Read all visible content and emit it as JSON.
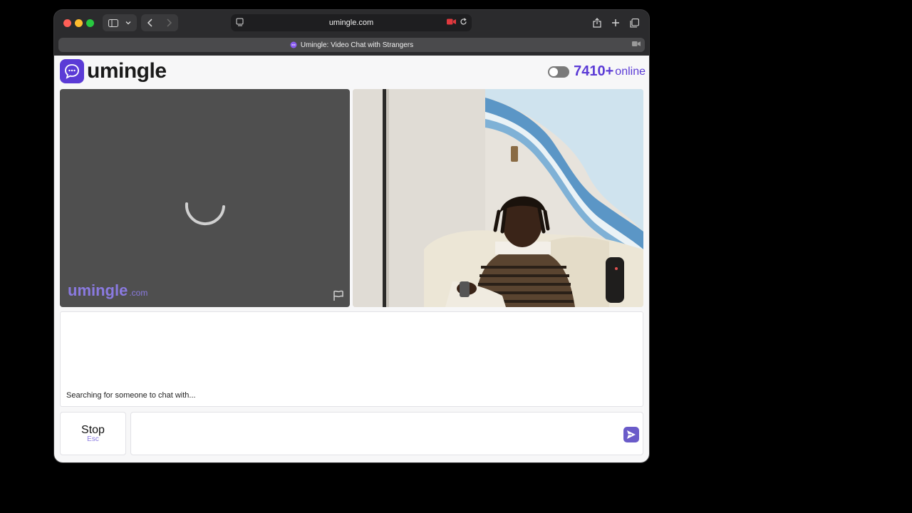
{
  "browser": {
    "url": "umingle.com",
    "tab_title": "Umingle: Video Chat with Strangers",
    "icons": {
      "sidebar": "sidebar-icon",
      "back": "chevron-left-icon",
      "forward": "chevron-right-icon",
      "reader": "reader-icon",
      "camera": "camera-recording-icon",
      "reload": "reload-icon",
      "share": "share-icon",
      "new_tab": "plus-icon",
      "tabs": "tab-overview-icon"
    }
  },
  "header": {
    "logo_text": "umingle",
    "online_count": "7410+",
    "online_label": "online"
  },
  "video": {
    "watermark_main": "umingle",
    "watermark_suffix": ".com"
  },
  "chat": {
    "status": "Searching for someone to chat with...",
    "message_placeholder": ""
  },
  "controls": {
    "stop_label": "Stop",
    "stop_key": "Esc"
  },
  "colors": {
    "brand": "#5b3bd6",
    "brand_light": "#8a7ae0",
    "send": "#6a5bc9"
  }
}
